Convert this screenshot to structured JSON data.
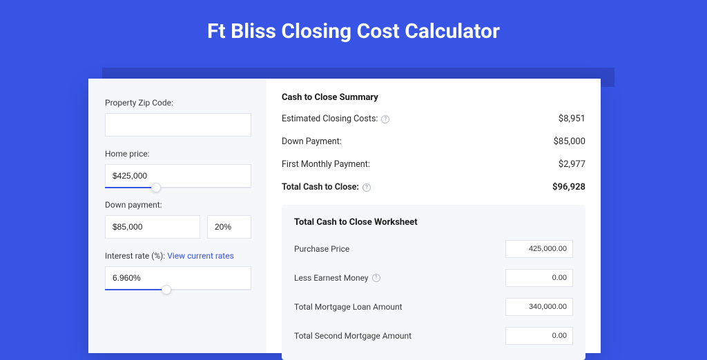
{
  "title": "Ft Bliss Closing Cost Calculator",
  "form": {
    "zip_label": "Property Zip Code:",
    "zip_value": "",
    "home_price_label": "Home price:",
    "home_price_value": "$425,000",
    "down_payment_label": "Down payment:",
    "down_payment_value": "$85,000",
    "down_payment_pct": "20%",
    "interest_label_prefix": "Interest rate (%): ",
    "interest_link": "View current rates",
    "interest_value": "6.960%"
  },
  "summary": {
    "heading": "Cash to Close Summary",
    "est_costs_label": "Estimated Closing Costs:",
    "est_costs_value": "$8,951",
    "down_payment_label": "Down Payment:",
    "down_payment_value": "$85,000",
    "first_payment_label": "First Monthly Payment:",
    "first_payment_value": "$2,977",
    "total_label": "Total Cash to Close:",
    "total_value": "$96,928"
  },
  "worksheet": {
    "heading": "Total Cash to Close Worksheet",
    "rows": [
      {
        "label": "Purchase Price",
        "help": false,
        "value": "425,000.00"
      },
      {
        "label": "Less Earnest Money",
        "help": true,
        "value": "0.00"
      },
      {
        "label": "Total Mortgage Loan Amount",
        "help": false,
        "value": "340,000.00"
      },
      {
        "label": "Total Second Mortgage Amount",
        "help": false,
        "value": "0.00"
      }
    ]
  },
  "slider": {
    "home_fill_pct": 35,
    "interest_fill_pct": 42
  }
}
